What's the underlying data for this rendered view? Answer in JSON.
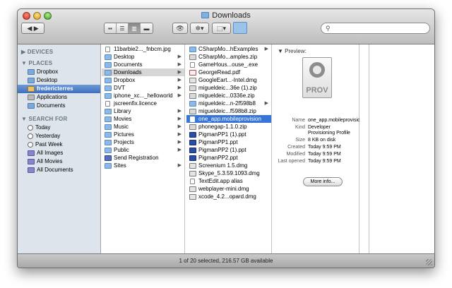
{
  "window": {
    "title": "Downloads",
    "status": "1 of 20 selected, 216.57 GB available"
  },
  "toolbar": {
    "back_forward": "◀ ▶",
    "view_buttons": [
      "▪▪",
      "☰",
      "▥",
      "▬"
    ],
    "quicklook": "👁",
    "action": "✲▾",
    "share": "⬚▾",
    "search_placeholder": ""
  },
  "sidebar": {
    "devices_label": "DEVICES",
    "places_label": "PLACES",
    "places": [
      {
        "label": "Dropbox",
        "icon": "folder-icon"
      },
      {
        "label": "Desktop",
        "icon": "desktop-icon"
      },
      {
        "label": "fredericterres",
        "icon": "home-icon"
      },
      {
        "label": "Applications",
        "icon": "applications-icon"
      },
      {
        "label": "Documents",
        "icon": "documents-icon"
      }
    ],
    "search_label": "SEARCH FOR",
    "searches": [
      {
        "label": "Today",
        "icon": "clock-icon"
      },
      {
        "label": "Yesterday",
        "icon": "clock-icon"
      },
      {
        "label": "Past Week",
        "icon": "clock-icon"
      },
      {
        "label": "All Images",
        "icon": "smart-folder-icon"
      },
      {
        "label": "All Movies",
        "icon": "smart-folder-icon"
      },
      {
        "label": "All Documents",
        "icon": "smart-folder-icon"
      }
    ]
  },
  "column1": [
    {
      "label": "11barbie2..._fnbcm.jpg",
      "kind": "doc",
      "arrow": false
    },
    {
      "label": "Desktop",
      "kind": "folder",
      "arrow": true
    },
    {
      "label": "Documents",
      "kind": "folder",
      "arrow": true
    },
    {
      "label": "Downloads",
      "kind": "folder",
      "arrow": true
    },
    {
      "label": "Dropbox",
      "kind": "folder",
      "arrow": true
    },
    {
      "label": "DVT",
      "kind": "folder",
      "arrow": true
    },
    {
      "label": "iphone_xc..._helloworld",
      "kind": "folder",
      "arrow": true
    },
    {
      "label": "jscreenfix.licence",
      "kind": "doc",
      "arrow": false
    },
    {
      "label": "Library",
      "kind": "folder",
      "arrow": true
    },
    {
      "label": "Movies",
      "kind": "folder",
      "arrow": true
    },
    {
      "label": "Music",
      "kind": "folder",
      "arrow": true
    },
    {
      "label": "Pictures",
      "kind": "folder",
      "arrow": true
    },
    {
      "label": "Projects",
      "kind": "folder",
      "arrow": true
    },
    {
      "label": "Public",
      "kind": "folder",
      "arrow": true
    },
    {
      "label": "Send Registration",
      "kind": "app",
      "arrow": false
    },
    {
      "label": "Sites",
      "kind": "folder",
      "arrow": true
    }
  ],
  "column2": [
    {
      "label": "CSharpMo...hExamples",
      "kind": "folder",
      "arrow": true
    },
    {
      "label": "CSharpMo...amples.zip",
      "kind": "zip",
      "arrow": false
    },
    {
      "label": "GameHous...ouse_.exe",
      "kind": "doc",
      "arrow": false
    },
    {
      "label": "GeorgeRead.pdf",
      "kind": "pdf",
      "arrow": false
    },
    {
      "label": "GoogleEart...-Intel.dmg",
      "kind": "dmg",
      "arrow": false
    },
    {
      "label": "migueldeic...36e (1).zip",
      "kind": "zip",
      "arrow": false
    },
    {
      "label": "migueldeic...0336e.zip",
      "kind": "zip",
      "arrow": false
    },
    {
      "label": "migueldeic...n-2f598b8",
      "kind": "folder",
      "arrow": true
    },
    {
      "label": "migueldeic...f598b8.zip",
      "kind": "zip",
      "arrow": false
    },
    {
      "label": "one_app.mobileprovision",
      "kind": "doc",
      "arrow": false
    },
    {
      "label": "phonegap-1.1.0.zip",
      "kind": "zip",
      "arrow": false
    },
    {
      "label": "PigmanPP1 (1).ppt",
      "kind": "ppt",
      "arrow": false
    },
    {
      "label": "PigmanPP1.ppt",
      "kind": "ppt",
      "arrow": false
    },
    {
      "label": "PigmanPP2 (1).ppt",
      "kind": "ppt",
      "arrow": false
    },
    {
      "label": "PigmanPP2.ppt",
      "kind": "ppt",
      "arrow": false
    },
    {
      "label": "Screenium 1.5.dmg",
      "kind": "dmg",
      "arrow": false
    },
    {
      "label": "Skype_5.3.59.1093.dmg",
      "kind": "dmg",
      "arrow": false
    },
    {
      "label": "TextEdit.app alias",
      "kind": "doc",
      "arrow": false
    },
    {
      "label": "webplayer-mini.dmg",
      "kind": "dmg",
      "arrow": false
    },
    {
      "label": "xcode_4.2...opard.dmg",
      "kind": "dmg",
      "arrow": false
    }
  ],
  "preview": {
    "label": "Preview:",
    "icon_text": "PROV",
    "info": [
      {
        "key": "Name",
        "value": "one_app.mobileprovision"
      },
      {
        "key": "Kind",
        "value": "Developer Provisioning Profile"
      },
      {
        "key": "Size",
        "value": "8 KB on disk"
      },
      {
        "key": "Created",
        "value": "Today 9:59 PM"
      },
      {
        "key": "Modified",
        "value": "Today 9:59 PM"
      },
      {
        "key": "Last opened",
        "value": "Today 9:59 PM"
      }
    ],
    "more_info": "More info..."
  },
  "colors": {
    "selection_blue": "#3875d7",
    "sidebar_bg": "#dde4eb",
    "selection_gray": "#d6d6d6"
  }
}
